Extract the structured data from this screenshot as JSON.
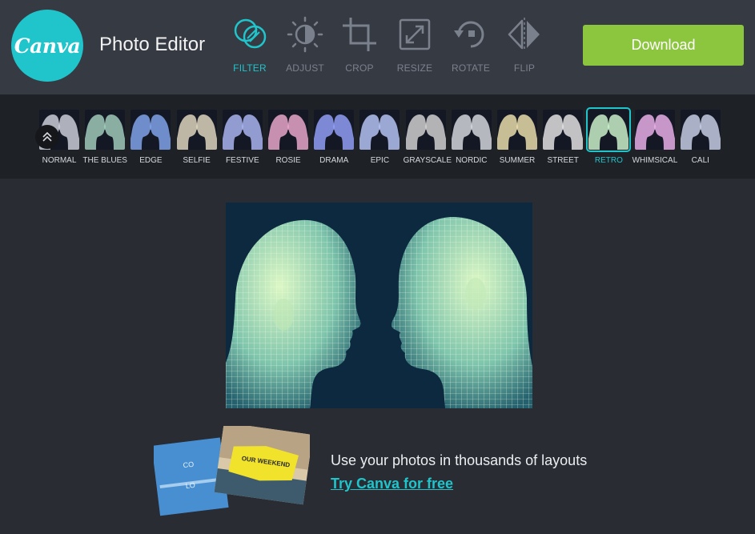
{
  "header": {
    "logo_text": "Canva",
    "title": "Photo Editor",
    "download_label": "Download",
    "accent_color": "#20c4cb",
    "download_color": "#8cc63f"
  },
  "tools": [
    {
      "label": "FILTER",
      "icon": "filter-icon",
      "active": true
    },
    {
      "label": "ADJUST",
      "icon": "adjust-icon",
      "active": false
    },
    {
      "label": "CROP",
      "icon": "crop-icon",
      "active": false
    },
    {
      "label": "RESIZE",
      "icon": "resize-icon",
      "active": false
    },
    {
      "label": "ROTATE",
      "icon": "rotate-icon",
      "active": false
    },
    {
      "label": "FLIP",
      "icon": "flip-icon",
      "active": false
    }
  ],
  "filters": [
    {
      "label": "NORMAL",
      "tint": "#c9ccd6",
      "active": false
    },
    {
      "label": "THE BLUES",
      "tint": "#9fcab9",
      "active": false
    },
    {
      "label": "EDGE",
      "tint": "#7fa2e8",
      "active": false
    },
    {
      "label": "SELFIE",
      "tint": "#dcd3bc",
      "active": false
    },
    {
      "label": "FESTIVE",
      "tint": "#a8b4f0",
      "active": false
    },
    {
      "label": "ROSIE",
      "tint": "#e8a6c9",
      "active": false
    },
    {
      "label": "DRAMA",
      "tint": "#8f9ef5",
      "active": false
    },
    {
      "label": "EPIC",
      "tint": "#b3c2f2",
      "active": false
    },
    {
      "label": "GRAYSCALE",
      "tint": "#cfcfcf",
      "active": false
    },
    {
      "label": "NORDIC",
      "tint": "#d2d5dc",
      "active": false
    },
    {
      "label": "SUMMER",
      "tint": "#e7dcaa",
      "active": false
    },
    {
      "label": "STREET",
      "tint": "#e1e1e1",
      "active": false
    },
    {
      "label": "RETRO",
      "tint": "#c9f0c8",
      "active": true
    },
    {
      "label": "WHIMSICAL",
      "tint": "#e6aee6",
      "active": false
    },
    {
      "label": "CALI",
      "tint": "#c4cbe3",
      "active": false
    }
  ],
  "promo": {
    "text": "Use your photos in thousands of layouts",
    "link": "Try Canva for free",
    "card_text": "OUR WEEKEND"
  }
}
